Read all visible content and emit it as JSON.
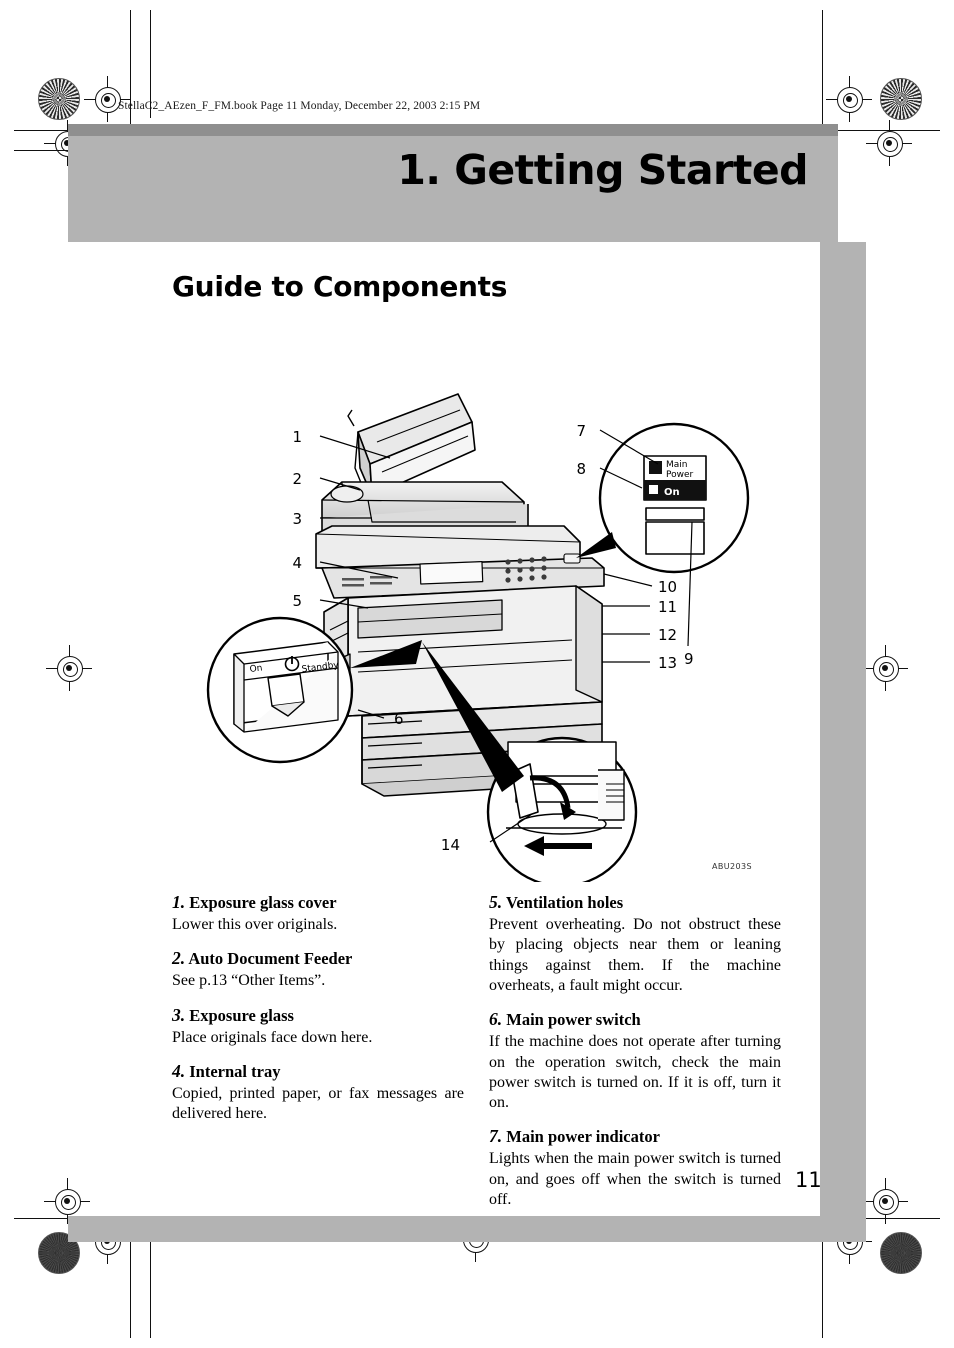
{
  "document": {
    "file_header": "StellaC2_AEzen_F_FM.book  Page 11  Monday, December 22, 2003  2:15 PM",
    "chapter_title": "1. Getting Started",
    "section_heading": "Guide to Components",
    "page_number": "11",
    "figure_code": "ABU203S"
  },
  "figure": {
    "callouts": [
      "1",
      "2",
      "3",
      "4",
      "5",
      "6",
      "7",
      "8",
      "9",
      "10",
      "11",
      "12",
      "13",
      "14"
    ],
    "detail_main_power": {
      "label_line1": "Main",
      "label_line2": "Power",
      "indicator_label": "On"
    },
    "detail_power_switch": {
      "on_label": "On",
      "standby_label": "Standby"
    }
  },
  "items": [
    {
      "num": "1.",
      "title": "Exposure glass cover",
      "body": "Lower this over originals."
    },
    {
      "num": "2.",
      "title": "Auto Document Feeder",
      "body": "See p.13 “Other Items”."
    },
    {
      "num": "3.",
      "title": "Exposure glass",
      "body": "Place originals face down here."
    },
    {
      "num": "4.",
      "title": "Internal tray",
      "body": "Copied, printed paper, or fax messages are delivered here."
    },
    {
      "num": "5.",
      "title": "Ventilation holes",
      "body": "Prevent overheating. Do not obstruct these by placing objects near them or leaning things against them. If the machine overheats, a fault might occur."
    },
    {
      "num": "6.",
      "title": "Main power switch",
      "body": "If the machine does not operate after turning on the operation switch, check the main power switch is turned on. If it is off, turn it on."
    },
    {
      "num": "7.",
      "title": "Main power indicator",
      "body": "Lights when the main power switch is turned on, and goes off when the switch is turned off."
    }
  ]
}
